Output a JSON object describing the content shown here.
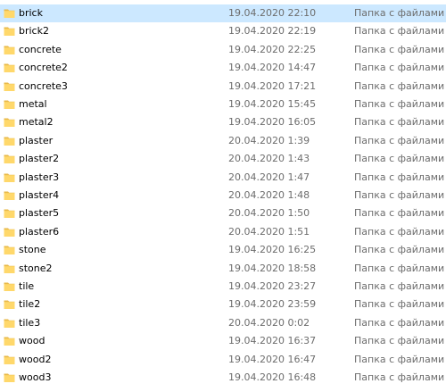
{
  "files": [
    {
      "name": "brick",
      "date": "19.04.2020 22:10",
      "type": "Папка с файлами",
      "selected": true
    },
    {
      "name": "brick2",
      "date": "19.04.2020 22:19",
      "type": "Папка с файлами"
    },
    {
      "name": "concrete",
      "date": "19.04.2020 22:25",
      "type": "Папка с файлами"
    },
    {
      "name": "concrete2",
      "date": "19.04.2020 14:47",
      "type": "Папка с файлами"
    },
    {
      "name": "concrete3",
      "date": "19.04.2020 17:21",
      "type": "Папка с файлами"
    },
    {
      "name": "metal",
      "date": "19.04.2020 15:45",
      "type": "Папка с файлами"
    },
    {
      "name": "metal2",
      "date": "19.04.2020 16:05",
      "type": "Папка с файлами"
    },
    {
      "name": "plaster",
      "date": "20.04.2020 1:39",
      "type": "Папка с файлами"
    },
    {
      "name": "plaster2",
      "date": "20.04.2020 1:43",
      "type": "Папка с файлами"
    },
    {
      "name": "plaster3",
      "date": "20.04.2020 1:47",
      "type": "Папка с файлами"
    },
    {
      "name": "plaster4",
      "date": "20.04.2020 1:48",
      "type": "Папка с файлами"
    },
    {
      "name": "plaster5",
      "date": "20.04.2020 1:50",
      "type": "Папка с файлами"
    },
    {
      "name": "plaster6",
      "date": "20.04.2020 1:51",
      "type": "Папка с файлами"
    },
    {
      "name": "stone",
      "date": "19.04.2020 16:25",
      "type": "Папка с файлами"
    },
    {
      "name": "stone2",
      "date": "19.04.2020 18:58",
      "type": "Папка с файлами"
    },
    {
      "name": "tile",
      "date": "19.04.2020 23:27",
      "type": "Папка с файлами"
    },
    {
      "name": "tile2",
      "date": "19.04.2020 23:59",
      "type": "Папка с файлами"
    },
    {
      "name": "tile3",
      "date": "20.04.2020 0:02",
      "type": "Папка с файлами"
    },
    {
      "name": "wood",
      "date": "19.04.2020 16:37",
      "type": "Папка с файлами"
    },
    {
      "name": "wood2",
      "date": "19.04.2020 16:47",
      "type": "Папка с файлами"
    },
    {
      "name": "wood3",
      "date": "19.04.2020 16:48",
      "type": "Папка с файлами"
    }
  ],
  "colors": {
    "selection": "#cce8ff",
    "folder_body": "#ffd86b",
    "folder_tab": "#e8b94a",
    "secondary_text": "#6d6d6d"
  },
  "icons": {
    "folder": "folder-icon"
  }
}
